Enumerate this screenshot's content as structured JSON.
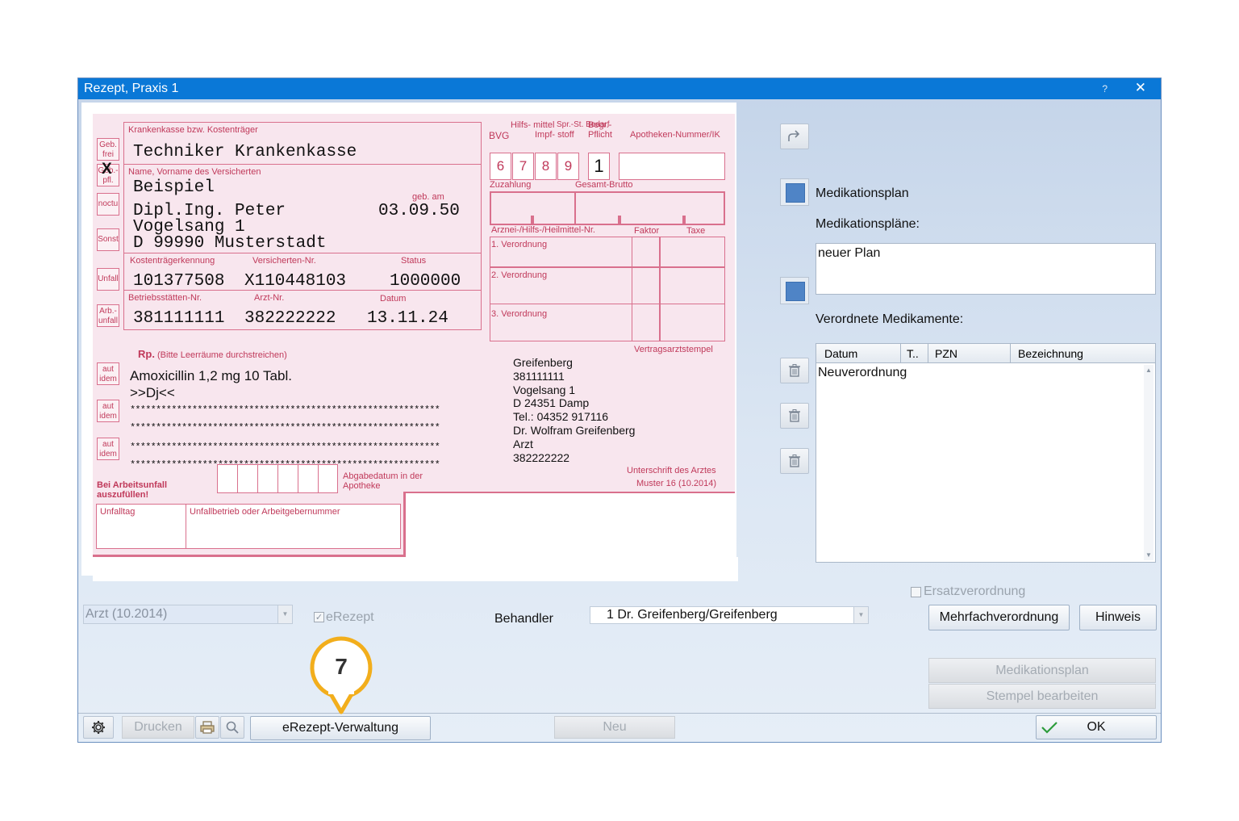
{
  "window": {
    "title": "Rezept, Praxis 1",
    "help": "?",
    "close": "✕"
  },
  "form": {
    "kostentraeger_label": "Krankenkasse bzw. Kostenträger",
    "kostentraeger": "Techniker Krankenkasse",
    "name_label": "Name, Vorname des Versicherten",
    "name_line1": "Beispiel",
    "name_line2": "Dipl.Ing. Peter",
    "street": "Vogelsang 1",
    "city": "D 99990 Musterstadt",
    "geb_label": "geb. am",
    "geb": "03.09.50",
    "side_boxes": [
      "Geb. frei",
      "Geb.- pfl.",
      "noctu",
      "Sonst",
      "Unfall",
      "Arb.- unfall"
    ],
    "gebpfl_mark": "X",
    "ktk_label": "Kostenträgerkennung",
    "vnr_label": "Versicherten-Nr.",
    "status_label": "Status",
    "ktk": "101377508",
    "vnr": "X110448103",
    "status": "1000000",
    "bsnr_label": "Betriebsstätten-Nr.",
    "arzt_label": "Arzt-Nr.",
    "datum_label": "Datum",
    "bsnr": "381111111",
    "arzt": "382222222",
    "datum": "13.11.24",
    "hilfs_label": "Hilfs- mittel",
    "impf_label": "Impf- stoff",
    "spr_label": "Spr.-St. Bedarf",
    "begr_label": "Begr.- Pflicht",
    "bvg_label": "BVG",
    "apotheke_label": "Apotheken-Nummer/IK",
    "digits": [
      "6",
      "7",
      "8",
      "9"
    ],
    "begr_value": "1",
    "zuzahlung_label": "Zuzahlung",
    "brutto_label": "Gesamt-Brutto",
    "arznei_label": "Arznei-/Hilfs-/Heilmittel-Nr.",
    "faktor_label": "Faktor",
    "taxe_label": "Taxe",
    "verordnungen": [
      "1. Verordnung",
      "2. Verordnung",
      "3. Verordnung"
    ],
    "rp_label": "Rp.",
    "rp_hint": "(Bitte Leerräume durchstreichen)",
    "med_line1": "Amoxicillin 1,2 mg 10 Tabl.",
    "med_line2": ">>Dj<<",
    "stars": "************************************************************",
    "aut_idem": "aut idem",
    "stempel_label": "Vertragsarztstempel",
    "stempel": [
      "Greifenberg",
      "381111111",
      "Vogelsang 1",
      "D 24351 Damp",
      "Tel.: 04352 917116",
      "Dr. Wolfram Greifenberg",
      "Arzt",
      "382222222"
    ],
    "abgabe_label": "Abgabedatum in der Apotheke",
    "unterschrift_label": "Unterschrift des Arztes",
    "muster_label": "Muster 16 (10.2014)",
    "arbeitsunfall_label": "Bei Arbeitsunfall auszufüllen!",
    "unfalltag_label": "Unfalltag",
    "unfallbetrieb_label": "Unfallbetrieb oder Arbeitgebernummer"
  },
  "right": {
    "medikationsplan_label": "Medikationsplan",
    "plaene_label": "Medikationspläne:",
    "plan_item": "neuer Plan",
    "verordnete_label": "Verordnete Medikamente:",
    "columns": [
      "Datum",
      "T..",
      "PZN",
      "Bezeichnung"
    ],
    "rows": [
      "Neuverordnung"
    ],
    "ersatz_label": "Ersatzverordnung",
    "mehrfach": "Mehrfachverordnung",
    "hinweis": "Hinweis",
    "medplan_btn": "Medikationsplan",
    "stempel_btn": "Stempel bearbeiten"
  },
  "bottom": {
    "formular_select": "Arzt (10.2014)",
    "erezept_label": "eRezept",
    "behandler_label": "Behandler",
    "behandler_value": "1 Dr. Greifenberg/Greifenberg",
    "drucken": "Drucken",
    "erezept_verwaltung": "eRezept-Verwaltung",
    "neu": "Neu",
    "ok": "OK",
    "callout": "7"
  },
  "colors": {
    "titlebar": "#0a78d7",
    "form_pink": "#f8e6ee",
    "form_red": "#c0395a",
    "accent_blue": "#4f84c6",
    "callout": "#f2ae1c"
  }
}
